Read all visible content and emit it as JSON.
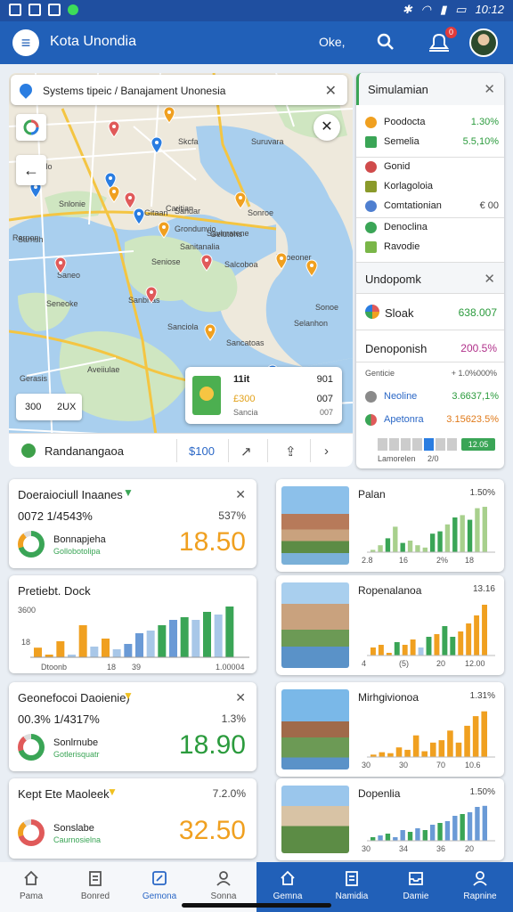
{
  "status": {
    "right_text": "10:12"
  },
  "appbar": {
    "title": "Kota Unondia",
    "location": "Oke,",
    "badge": "0"
  },
  "map": {
    "search_text": "Systems tipeic / Banajament Unonesia",
    "labels": [
      "Sentolo",
      "Sarnsh",
      "Skcfa",
      "Suruvara",
      "Snlonie",
      "Caritian",
      "Grondunvio",
      "Sanitanalia",
      "Savimatene",
      "Sonroe",
      "Gitaan",
      "Rarnon",
      "Gelutons",
      "Sandar",
      "Saneo",
      "Sanciola",
      "Unoeoner",
      "Seneoke",
      "Sanbhas",
      "Seniose",
      "Sonoe",
      "Sancatoas",
      "Salcoboa",
      "Selanhon",
      "Gerasis",
      "Aveiiulae"
    ],
    "scale_a": "300",
    "scale_b": "2UX",
    "info": {
      "a": "11it",
      "b": "901",
      "c": "007",
      "d": "Sancia",
      "e": "£300"
    },
    "place_name": "Randanangaoa",
    "place_price": "$100"
  },
  "sim": {
    "title": "Simulamian",
    "rows1": [
      {
        "label": "Poodocta",
        "value": "1.30%",
        "color": "#f0a020",
        "vcolor": "#2b9b3d"
      },
      {
        "label": "Semelia",
        "value": "5.5,10%",
        "color": "#3aa556",
        "vcolor": "#2b9b3d"
      }
    ],
    "rows2": [
      {
        "label": "Gonid",
        "value": "",
        "color": "#d04b4b"
      },
      {
        "label": "Korlagoloia",
        "value": "",
        "color": "#8a9a2a"
      },
      {
        "label": "Comtationian",
        "value": "€ 00",
        "color": "#4f7fd0"
      }
    ],
    "rows3": [
      {
        "label": "Denoclina",
        "value": "",
        "color": "#3aa556"
      },
      {
        "label": "Ravodie",
        "value": "",
        "color": "#7ab648"
      }
    ],
    "panel2_title": "Undopomk",
    "stock_label": "Sloak",
    "stock_value": "638.007",
    "dept_label": "Denoponish",
    "dept_value": "200.5%",
    "header_row": "Genticie",
    "header_val": "+ 1.0%000%",
    "rows4": [
      {
        "label": "Neoline",
        "value": "3.6637,1%",
        "vcolor": "#2b9b3d"
      },
      {
        "label": "Apetonra",
        "value": "3.15623.5%",
        "vcolor": "#e07a1a"
      }
    ],
    "bar_labels": [
      "Lamorelen",
      "2/0"
    ],
    "bar_btn": "12.05"
  },
  "cards_left": [
    {
      "title": "Doeraiociull Inaanes",
      "sub": "0072 1/4543%",
      "pct": "537%",
      "dname": "Bonnapjeha",
      "dsub": "Gollobotolipa",
      "big": "18.50",
      "bigcolor": "#f0a020",
      "d1": "#3aa556",
      "d2": "#f0a020"
    },
    {
      "title": "Pretiebt. Dock",
      "chart": true,
      "xlabels": [
        "Dtoonb",
        "18",
        "39",
        "1.00004"
      ],
      "ylab1": "3600",
      "ylab2": "18",
      "values": [
        0.18,
        0.05,
        0.3,
        0.05,
        0.6,
        0.2,
        0.35,
        0.15,
        0.25,
        0.45,
        0.5,
        0.6,
        0.7,
        0.75,
        0.7,
        0.85,
        0.8,
        0.95
      ],
      "colors": [
        "#f0a020",
        "#f0a020",
        "#f0a020",
        "#a8c7e8",
        "#f0a020",
        "#a8c7e8",
        "#f0a020",
        "#a8c7e8",
        "#6a9ad6",
        "#6a9ad6",
        "#a8c7e8",
        "#3aa556",
        "#6a9ad6",
        "#3aa556",
        "#a8c7e8",
        "#3aa556",
        "#a8c7e8",
        "#3aa556"
      ]
    },
    {
      "title": "Geonefocoi Daoienie)",
      "sub": "00.3% 1/4317%",
      "pct": "1.3%",
      "dname": "Sonlrnube",
      "dsub": "Gotlerisquatr",
      "big": "18.90",
      "bigcolor": "#2b9b3d",
      "d1": "#3aa556",
      "d2": "#e05a5a"
    },
    {
      "title": "Kept Ete Maoleek",
      "sub": "",
      "pct": "7.2.0%",
      "dname": "Sonslabe",
      "dsub": "Caurnosielna",
      "big": "32.50",
      "bigcolor": "#f0a020",
      "d1": "#e05a5a",
      "d2": "#f0a020"
    }
  ],
  "cards_right": [
    {
      "title": "Palan",
      "pct": "1.50%",
      "xlabels": [
        "2.8",
        "16",
        "2%",
        "18"
      ],
      "values": [
        0.05,
        0.15,
        0.3,
        0.55,
        0.2,
        0.25,
        0.15,
        0.1,
        0.4,
        0.45,
        0.6,
        0.75,
        0.8,
        0.7,
        0.95,
        0.98
      ],
      "colors": [
        "#a8d08d",
        "#a8d08d",
        "#3aa556",
        "#a8d08d",
        "#3aa556",
        "#a8d08d",
        "#a8d08d",
        "#a8d08d",
        "#3aa556",
        "#3aa556",
        "#a8d08d",
        "#3aa556",
        "#a8d08d",
        "#3aa556",
        "#a8d08d",
        "#a8d08d"
      ],
      "photo": "a"
    },
    {
      "title": "Ropenalanoa",
      "pct": "13.16",
      "xlabels": [
        "4",
        "(5)",
        "20",
        "12.00"
      ],
      "values": [
        0.15,
        0.2,
        0.05,
        0.25,
        0.2,
        0.3,
        0.15,
        0.35,
        0.4,
        0.55,
        0.35,
        0.45,
        0.6,
        0.75,
        0.95
      ],
      "colors": [
        "#f0a020",
        "#f0a020",
        "#f0a020",
        "#3aa556",
        "#f0a020",
        "#f0a020",
        "#a8c7e8",
        "#3aa556",
        "#f0a020",
        "#3aa556",
        "#3aa556",
        "#f0a020",
        "#f0a020",
        "#f0a020",
        "#f0a020"
      ],
      "photo": "b"
    },
    {
      "title": "Mirhgivionoa",
      "pct": "1.31%",
      "xlabels": [
        "30",
        "30",
        "70",
        "10.6"
      ],
      "values": [
        0.05,
        0.1,
        0.08,
        0.2,
        0.15,
        0.45,
        0.12,
        0.3,
        0.35,
        0.55,
        0.3,
        0.65,
        0.85,
        0.95
      ],
      "colors": [
        "#f0a020",
        "#f0a020",
        "#f0a020",
        "#f0a020",
        "#f0a020",
        "#f0a020",
        "#f0a020",
        "#f0a020",
        "#f0a020",
        "#f0a020",
        "#f0a020",
        "#f0a020",
        "#f0a020",
        "#f0a020"
      ],
      "photo": "c"
    },
    {
      "title": "Dopenlia",
      "pct": "1.50%",
      "xlabels": [
        "30",
        "34",
        "36",
        "20"
      ],
      "values": [
        0.1,
        0.15,
        0.2,
        0.1,
        0.3,
        0.25,
        0.35,
        0.3,
        0.45,
        0.5,
        0.55,
        0.7,
        0.75,
        0.8,
        0.95,
        0.98
      ],
      "colors": [
        "#3aa556",
        "#6a9ad6",
        "#3aa556",
        "#6a9ad6",
        "#6a9ad6",
        "#3aa556",
        "#6a9ad6",
        "#3aa556",
        "#6a9ad6",
        "#3aa556",
        "#6a9ad6",
        "#6a9ad6",
        "#3aa556",
        "#6a9ad6",
        "#6a9ad6",
        "#6a9ad6"
      ],
      "photo": "d"
    }
  ],
  "nav_left": [
    {
      "label": "Pama",
      "icon": "home-icon"
    },
    {
      "label": "Bonred",
      "icon": "document-icon"
    },
    {
      "label": "Gemona",
      "icon": "edit-icon"
    },
    {
      "label": "Sonna",
      "icon": "user-icon"
    }
  ],
  "nav_right": [
    {
      "label": "Gemna",
      "icon": "home-icon"
    },
    {
      "label": "Namidia",
      "icon": "document-icon"
    },
    {
      "label": "Damie",
      "icon": "inbox-icon"
    },
    {
      "label": "Rapnine",
      "icon": "user-icon"
    }
  ]
}
